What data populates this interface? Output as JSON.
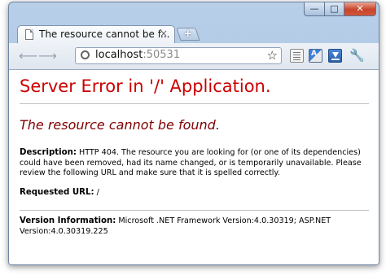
{
  "browser": {
    "tab_title": "The resource cannot be f...",
    "tab_close": "×",
    "new_tab": "+",
    "url_host": "localhost",
    "url_port": ":50531",
    "window_controls": {
      "minimize": "—",
      "maximize": "□",
      "close": "✕"
    },
    "icons": [
      "back-icon",
      "forward-icon",
      "page-icon",
      "star-icon",
      "page-action-icon",
      "translate-icon",
      "download-icon",
      "wrench-icon"
    ]
  },
  "page": {
    "heading": "Server Error in '/' Application.",
    "subheading": "The resource cannot be found.",
    "description_label": "Description:",
    "description_text": "HTTP 404. The resource you are looking for (or one of its dependencies) could have been removed, had its name changed, or is temporarily unavailable.  Please review the following URL and make sure that it is spelled correctly.",
    "requested_url_label": "Requested URL:",
    "requested_url_value": "/",
    "version_label": "Version Information:",
    "version_text": "Microsoft .NET Framework Version:4.0.30319; ASP.NET Version:4.0.30319.225"
  },
  "colors": {
    "error_red": "#cc0000",
    "subheading_maroon": "#800000"
  }
}
